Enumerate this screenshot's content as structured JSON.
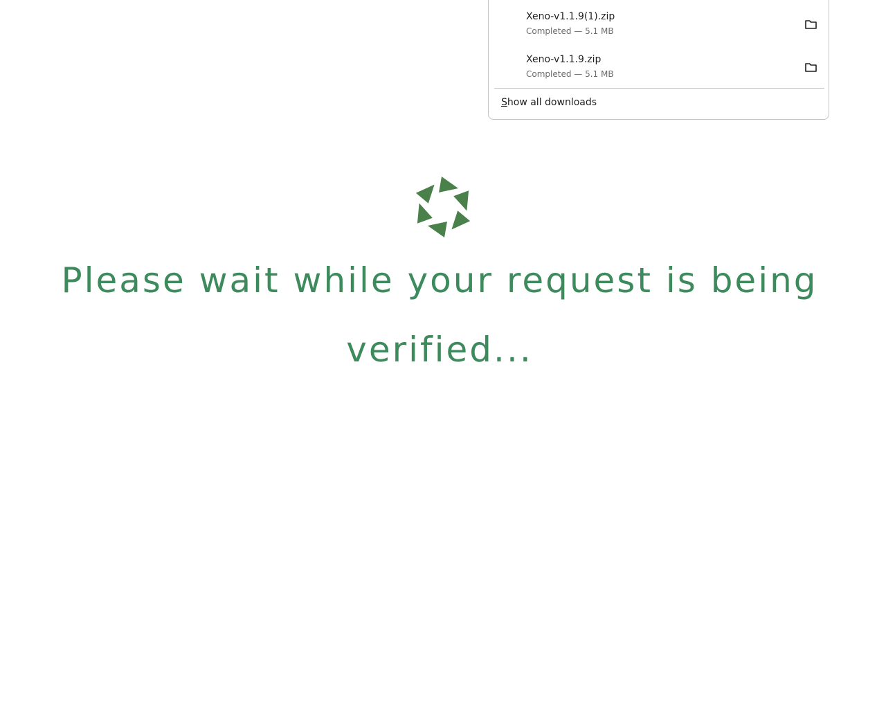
{
  "downloads": {
    "items": [
      {
        "file_name": "Xeno-v1.1.9(1).zip",
        "status": "Completed — 5.1 MB",
        "icon": "folder-icon"
      },
      {
        "file_name": "Xeno-v1.1.9.zip",
        "status": "Completed — 5.1 MB",
        "icon": "folder-icon"
      }
    ],
    "show_all_mnemonic": "S",
    "show_all_rest": "how all downloads"
  },
  "main": {
    "message": "Please wait while your request is being verified...",
    "logo_icon": "spinning-arrows-logo",
    "accent_color": "#3d8a5c",
    "logo_color": "#4a8049"
  }
}
